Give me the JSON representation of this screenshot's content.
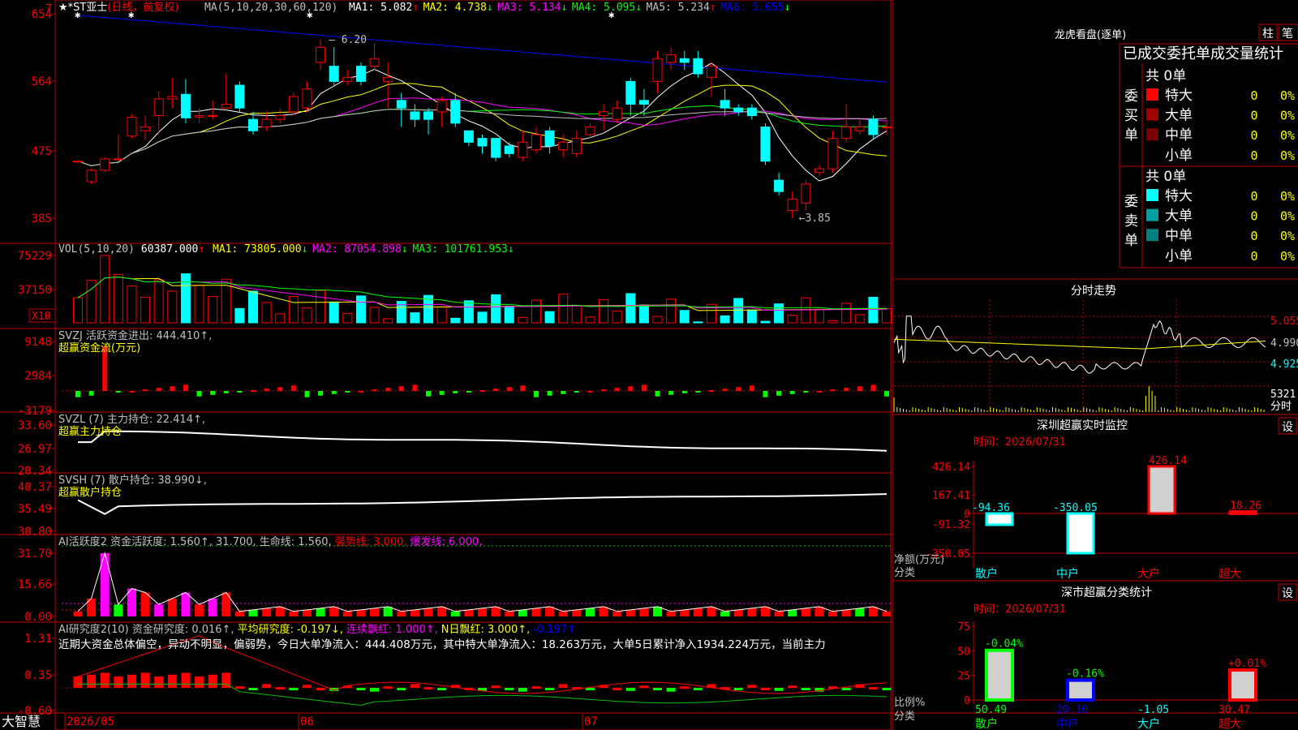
{
  "stock": {
    "name": "★*ST亚士",
    "period": "(日线，前复权)",
    "ma_label": "MA(5,10,20,30,60,120)",
    "ma": [
      {
        "label": "MA1: 5.082",
        "arrow": "↑",
        "color": "#ffffff"
      },
      {
        "label": "MA2: 4.738",
        "arrow": "↓",
        "color": "#ffff00"
      },
      {
        "label": "MA3: 5.134",
        "arrow": "↓",
        "color": "#ff00ff"
      },
      {
        "label": "MA4: 5.095",
        "arrow": "↓",
        "color": "#00ff00"
      },
      {
        "label": "MA5: 5.234",
        "arrow": "↑",
        "color": "#c0c0c0"
      },
      {
        "label": "MA6: 5.655",
        "arrow": "↓",
        "color": "#0000ff"
      }
    ],
    "price_ticks": [
      "654",
      "564",
      "475",
      "385"
    ],
    "high_label": "6.20",
    "low_label": "3.85",
    "corner_mark": "7"
  },
  "volume": {
    "label": "VOL(5,10,20)",
    "value": "60387.000",
    "ma": [
      {
        "label": "MA1: 73805.000",
        "arrow": "↓",
        "color": "#ffff00"
      },
      {
        "label": "MA2: 87054.898",
        "arrow": "↓",
        "color": "#ff00ff"
      },
      {
        "label": "MA3: 101761.953",
        "arrow": "↓",
        "color": "#00ff00"
      }
    ],
    "ticks": [
      "75229",
      "37150"
    ],
    "unit": "X10"
  },
  "svzj": {
    "label": "SVZJ  活跃资金进出: 444.410↑,",
    "sub": "超赢资金流(万元)",
    "ticks": [
      "9148",
      "2984",
      "-3179"
    ]
  },
  "svzl": {
    "label": "SVZL (7) 主力持仓: 22.414↑,",
    "sub": "超赢主力持仓",
    "ticks": [
      "33.60",
      "26.97",
      "20.34"
    ]
  },
  "svsh": {
    "label": "SVSH (7) 散户持仓: 38.990↓,",
    "sub": "超赢散户持仓",
    "ticks": [
      "40.37",
      "35.49",
      "30.80"
    ]
  },
  "ai_active": {
    "label": "AI活跃度2 资金活跃度: 1.560↑, 31.700, 生命线: 1.560,",
    "strong": "强势线: 3.000,",
    "burst": "爆发线: 6.000,",
    "ticks": [
      "31.70",
      "15.66",
      "0.00"
    ]
  },
  "ai_research": {
    "label": "AI研究度2(10) 资金研究度: 0.016↑,",
    "avg": "平均研究度: -0.197↓,",
    "streak": "连续飘红: 1.000↑,",
    "nday": "N日飘红: 3.000↑,",
    "last": "-0.197↑",
    "comment": "近期大资金总体偏空，异动不明显，偏弱势，今日大单净流入：444.408万元，其中特大单净流入：18.263万元，大单5日累计净入1934.224万元，当前主力",
    "ticks": [
      "1.31",
      "0.35",
      "-0.60"
    ]
  },
  "dates": [
    "2026/05",
    "06",
    "07"
  ],
  "brand": "大智慧",
  "right": {
    "lhb_title": "龙虎看盘(逐单)",
    "btn_zhu": "柱",
    "btn_bi": "笔",
    "lhb_subtitle": "已成交委托单成交量统计",
    "buy_side": "委买单",
    "sell_side": "委卖单",
    "buy_total": "共 0单",
    "sell_total": "共 0单",
    "buy_rows": [
      {
        "name": "特大",
        "count": "0",
        "pct": "0%",
        "color": "#ff0000"
      },
      {
        "name": "大单",
        "count": "0",
        "pct": "0%",
        "color": "#a00000"
      },
      {
        "name": "中单",
        "count": "0",
        "pct": "0%",
        "color": "#7a0000"
      },
      {
        "name": "小单",
        "count": "0",
        "pct": "0%",
        "color": "#000000"
      }
    ],
    "sell_rows": [
      {
        "name": "特大",
        "count": "0",
        "pct": "0%",
        "color": "#00ffff"
      },
      {
        "name": "大单",
        "count": "0",
        "pct": "0%",
        "color": "#00a0a0"
      },
      {
        "name": "中单",
        "count": "0",
        "pct": "0%",
        "color": "#008080"
      },
      {
        "name": "小单",
        "count": "0",
        "pct": "0%",
        "color": "#000000"
      }
    ],
    "fs_title": "分时走势",
    "fs_ticks": [
      "5.055",
      "4.990",
      "4.925"
    ],
    "fs_vol": "5321",
    "fs_vol_label": "分时",
    "sz_title": "深圳超赢实时监控",
    "sz_time": "时间：2026/07/31",
    "sz_ticks": [
      "426.14",
      "167.41",
      "0",
      "-91.32",
      "-350.05"
    ],
    "sz_ylabel": "净额(万元)",
    "sz_xlabel": "分类",
    "cls_title": "深市超赢分类统计",
    "cls_time": "时间：2026/07/31",
    "cls_ticks": [
      "75",
      "50",
      "25",
      "0"
    ],
    "cls_ylabel": "比例%",
    "cls_xlabel": "分类",
    "settings_label": "设"
  },
  "chart_data": [
    {
      "type": "bar",
      "title": "深圳超赢实时监控",
      "categories": [
        "散户",
        "中户",
        "大户",
        "超大"
      ],
      "values": [
        -94.36,
        -350.05,
        426.14,
        18.26
      ],
      "ylabel": "净额(万元)",
      "xlabel": "分类",
      "ylim": [
        -350.05,
        426.14
      ],
      "colors": [
        "#00ffff",
        "#00ffff",
        "#ff0000",
        "#ff0000"
      ]
    },
    {
      "type": "bar",
      "title": "深市超赢分类统计",
      "categories": [
        "散户",
        "中户",
        "大户",
        "超大"
      ],
      "values": [
        50.49,
        20.1,
        -1.05,
        30.47
      ],
      "changes": [
        "-0.04%",
        "-0.16%",
        "",
        "+0.01%"
      ],
      "ylabel": "比例%",
      "xlabel": "分类",
      "ylim": [
        0,
        75
      ],
      "colors": [
        "#00ff00",
        "#0000ff",
        "#00ffff",
        "#ff0000"
      ]
    },
    {
      "type": "line",
      "title": "K线",
      "y_ticks": [
        6.54,
        5.64,
        4.75,
        3.85
      ],
      "high": 6.2,
      "low": 3.85,
      "candles": [
        {
          "o": 4.6,
          "c": 4.6,
          "h": 4.6,
          "l": 4.6
        },
        {
          "o": 4.33,
          "c": 4.48,
          "h": 4.5,
          "l": 4.3
        },
        {
          "o": 4.48,
          "c": 4.63,
          "h": 4.65,
          "l": 4.46
        },
        {
          "o": 4.63,
          "c": 4.63,
          "h": 4.95,
          "l": 4.6
        },
        {
          "o": 4.93,
          "c": 5.18,
          "h": 5.22,
          "l": 4.9
        },
        {
          "o": 5.0,
          "c": 5.05,
          "h": 5.2,
          "l": 4.88
        },
        {
          "o": 5.2,
          "c": 5.42,
          "h": 5.52,
          "l": 4.95
        },
        {
          "o": 5.42,
          "c": 5.45,
          "h": 5.7,
          "l": 5.3
        },
        {
          "o": 5.48,
          "c": 5.17,
          "h": 5.68,
          "l": 5.1
        },
        {
          "o": 5.18,
          "c": 5.2,
          "h": 5.3,
          "l": 5.1
        },
        {
          "o": 5.2,
          "c": 5.2,
          "h": 5.4,
          "l": 5.15
        },
        {
          "o": 5.3,
          "c": 5.35,
          "h": 5.75,
          "l": 5.3
        },
        {
          "o": 5.6,
          "c": 5.3,
          "h": 5.65,
          "l": 5.25
        },
        {
          "o": 5.15,
          "c": 5.0,
          "h": 5.25,
          "l": 4.95
        },
        {
          "o": 5.05,
          "c": 5.15,
          "h": 5.25,
          "l": 5.0
        },
        {
          "o": 5.15,
          "c": 5.2,
          "h": 5.3,
          "l": 5.1
        },
        {
          "o": 5.25,
          "c": 5.45,
          "h": 5.5,
          "l": 5.2
        },
        {
          "o": 5.3,
          "c": 5.55,
          "h": 5.65,
          "l": 5.25
        },
        {
          "o": 5.9,
          "c": 6.1,
          "h": 6.2,
          "l": 5.8
        },
        {
          "o": 5.85,
          "c": 5.65,
          "h": 6.1,
          "l": 5.6
        },
        {
          "o": 5.65,
          "c": 5.7,
          "h": 5.8,
          "l": 5.6
        },
        {
          "o": 5.85,
          "c": 5.65,
          "h": 5.9,
          "l": 5.6
        },
        {
          "o": 5.85,
          "c": 5.95,
          "h": 6.15,
          "l": 5.8
        },
        {
          "o": 5.65,
          "c": 5.7,
          "h": 5.9,
          "l": 5.3
        },
        {
          "o": 5.4,
          "c": 5.3,
          "h": 5.5,
          "l": 5.05
        },
        {
          "o": 5.25,
          "c": 5.15,
          "h": 5.35,
          "l": 5.05
        },
        {
          "o": 5.25,
          "c": 5.15,
          "h": 5.3,
          "l": 4.95
        },
        {
          "o": 5.25,
          "c": 5.4,
          "h": 5.45,
          "l": 5.05
        },
        {
          "o": 5.4,
          "c": 5.1,
          "h": 5.5,
          "l": 5.05
        },
        {
          "o": 5.0,
          "c": 4.85,
          "h": 5.0,
          "l": 4.8
        },
        {
          "o": 4.9,
          "c": 4.8,
          "h": 4.95,
          "l": 4.7
        },
        {
          "o": 4.9,
          "c": 4.65,
          "h": 4.9,
          "l": 4.6
        },
        {
          "o": 4.8,
          "c": 4.7,
          "h": 4.85,
          "l": 4.65
        },
        {
          "o": 4.65,
          "c": 4.85,
          "h": 5.0,
          "l": 4.6
        },
        {
          "o": 4.75,
          "c": 4.95,
          "h": 5.05,
          "l": 4.7
        },
        {
          "o": 5.0,
          "c": 4.8,
          "h": 5.05,
          "l": 4.7
        },
        {
          "o": 4.75,
          "c": 4.85,
          "h": 4.95,
          "l": 4.65
        },
        {
          "o": 4.7,
          "c": 4.9,
          "h": 5.0,
          "l": 4.65
        },
        {
          "o": 4.95,
          "c": 5.05,
          "h": 5.1,
          "l": 4.9
        },
        {
          "o": 5.2,
          "c": 5.25,
          "h": 5.35,
          "l": 5.0
        },
        {
          "o": 5.15,
          "c": 5.3,
          "h": 5.4,
          "l": 5.1
        },
        {
          "o": 5.65,
          "c": 5.35,
          "h": 5.7,
          "l": 5.2
        },
        {
          "o": 5.4,
          "c": 5.35,
          "h": 5.55,
          "l": 5.2
        },
        {
          "o": 5.65,
          "c": 5.95,
          "h": 6.05,
          "l": 5.5
        },
        {
          "o": 5.9,
          "c": 6.0,
          "h": 6.1,
          "l": 5.8
        },
        {
          "o": 5.95,
          "c": 5.9,
          "h": 6.05,
          "l": 5.8
        },
        {
          "o": 5.95,
          "c": 5.75,
          "h": 6.05,
          "l": 5.7
        },
        {
          "o": 5.7,
          "c": 5.85,
          "h": 5.9,
          "l": 5.45
        },
        {
          "o": 5.4,
          "c": 5.3,
          "h": 5.55,
          "l": 5.2
        },
        {
          "o": 5.3,
          "c": 5.25,
          "h": 5.35,
          "l": 5.2
        },
        {
          "o": 5.3,
          "c": 5.2,
          "h": 5.35,
          "l": 5.15
        },
        {
          "o": 5.05,
          "c": 4.6,
          "h": 5.1,
          "l": 4.55
        },
        {
          "o": 4.35,
          "c": 4.2,
          "h": 4.45,
          "l": 4.15
        },
        {
          "o": 3.95,
          "c": 4.1,
          "h": 4.2,
          "l": 3.85
        },
        {
          "o": 4.05,
          "c": 4.3,
          "h": 4.35,
          "l": 3.95
        },
        {
          "o": 4.45,
          "c": 4.5,
          "h": 4.55,
          "l": 4.4
        },
        {
          "o": 4.5,
          "c": 4.9,
          "h": 5.0,
          "l": 4.45
        },
        {
          "o": 4.9,
          "c": 5.05,
          "h": 5.35,
          "l": 4.85
        },
        {
          "o": 5.0,
          "c": 5.05,
          "h": 5.15,
          "l": 4.95
        },
        {
          "o": 5.15,
          "c": 4.95,
          "h": 5.2,
          "l": 4.9
        },
        {
          "o": 5.05,
          "c": 5.05,
          "h": 5.12,
          "l": 4.95
        }
      ]
    }
  ]
}
